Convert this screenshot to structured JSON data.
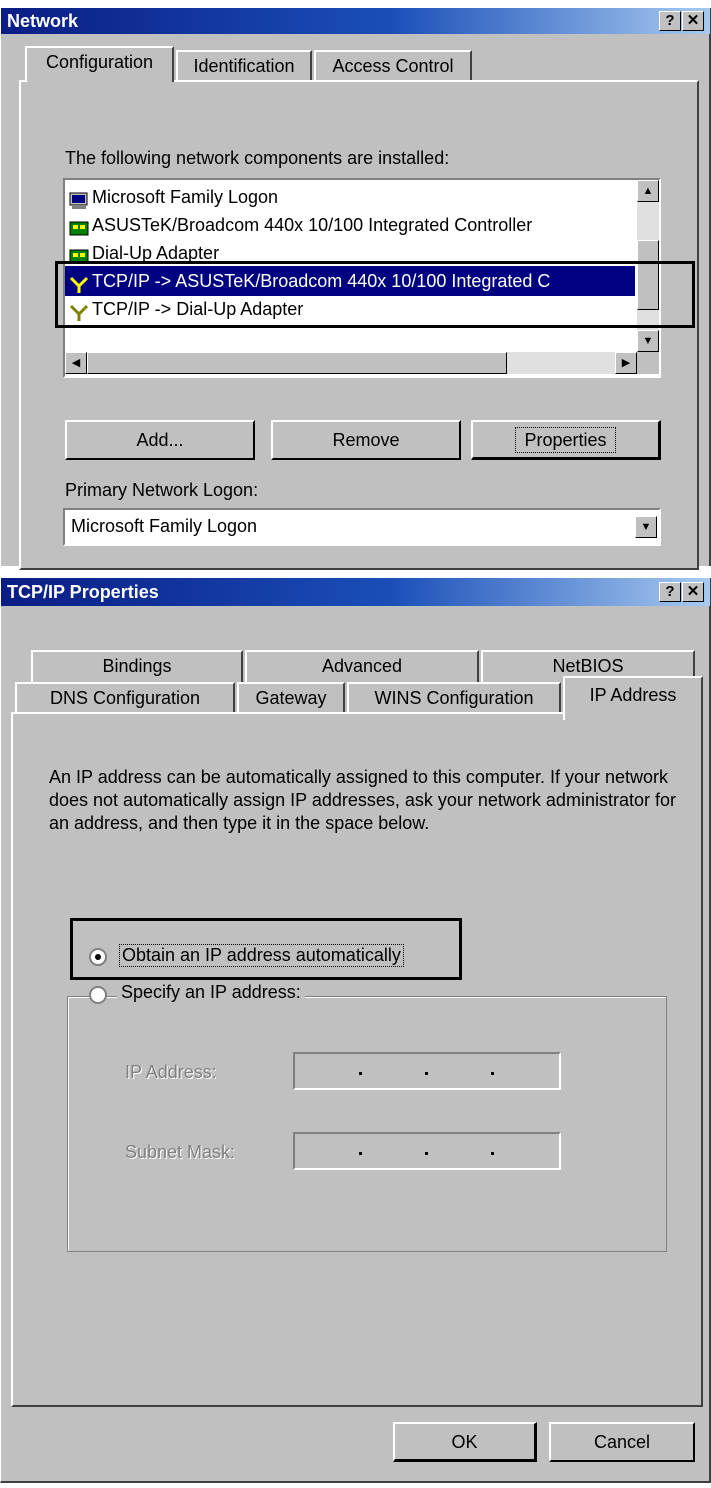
{
  "network_dialog": {
    "title": "Network",
    "tabs": [
      "Configuration",
      "Identification",
      "Access Control"
    ],
    "list_label": "The following network components are installed:",
    "components": [
      "Microsoft Family Logon",
      "ASUSTeK/Broadcom 440x 10/100 Integrated Controller",
      "Dial-Up Adapter",
      "TCP/IP -> ASUSTeK/Broadcom 440x 10/100 Integrated C",
      "TCP/IP -> Dial-Up Adapter"
    ],
    "buttons": {
      "add": "Add...",
      "remove": "Remove",
      "properties": "Properties"
    },
    "primary_logon_label": "Primary Network Logon:",
    "primary_logon_value": "Microsoft Family Logon"
  },
  "tcpip_dialog": {
    "title": "TCP/IP Properties",
    "tabs_row1": [
      "Bindings",
      "Advanced",
      "NetBIOS"
    ],
    "tabs_row2": [
      "DNS Configuration",
      "Gateway",
      "WINS Configuration",
      "IP Address"
    ],
    "description": "An IP address can be automatically assigned to this computer. If your network does not automatically assign IP addresses, ask your network administrator for an address, and then type it in the space below.",
    "option_auto": "Obtain an IP address automatically",
    "option_specify": "Specify an IP address:",
    "ip_label": "IP Address:",
    "subnet_label": "Subnet Mask:",
    "ok": "OK",
    "cancel": "Cancel"
  },
  "title_buttons": {
    "help": "?",
    "close": "✕"
  }
}
